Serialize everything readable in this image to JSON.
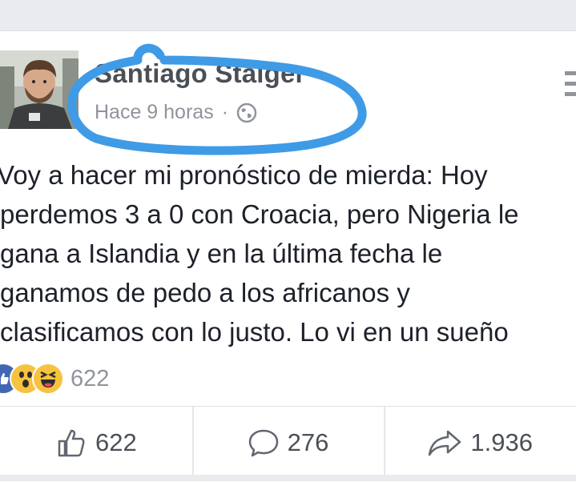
{
  "post": {
    "author": "Santiago Staiger",
    "time": "Hace 9 horas",
    "separator": "·",
    "text": "Voy a hacer mi pronóstico de mierda: Hoy\nperdemos 3 a 0 con Croacia, pero Nigeria le\ngana a Islandia y en la última fecha le\nganamos de pedo a los africanos y\nclasificamos con lo justo. Lo vi en un sueño"
  },
  "reactions": {
    "icons": [
      "like-icon",
      "wow-icon",
      "haha-icon"
    ],
    "count": "622"
  },
  "actions": {
    "like": "622",
    "comments": "276",
    "shares": "1.936"
  },
  "colors": {
    "highlight": "#3f9be6",
    "like": "#4267b2",
    "emoji": "#f7c240"
  }
}
